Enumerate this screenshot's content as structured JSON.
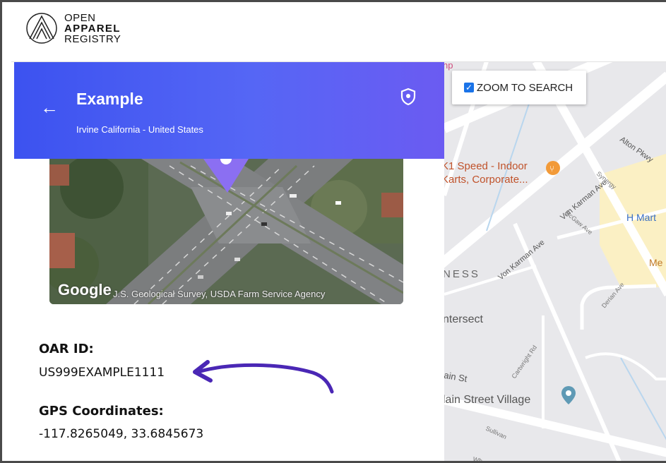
{
  "app": {
    "logo_line1": "OPEN",
    "logo_line2": "APPAREL",
    "logo_line3": "REGISTRY"
  },
  "facility": {
    "name": "Example",
    "location": "Irvine California - United States",
    "oar_id_label": "OAR ID:",
    "oar_id": "US999EXAMPLE1111",
    "gps_label": "GPS Coordinates:",
    "gps": "-117.8265049, 33.6845673"
  },
  "photo": {
    "provider": "Google",
    "attribution": "J.S. Geological Survey, USDA Farm Service Agency"
  },
  "map": {
    "zoom_label": "ZOOM TO SEARCH",
    "zoom_checked": true,
    "places": {
      "alton": "Alton Pkwy",
      "vonkarman1": "Von Karman Ave",
      "vonkarman2": "Von Karman Ave",
      "synergy": "Synergy",
      "mcgaw": "McGaw Ave",
      "hmart": "H Mart",
      "speed1": "K1 Speed - Indoor",
      "speed2": "Karts, Corporate...",
      "ness": "NESS",
      "me": "Me",
      "derian": "Derian Ave",
      "intersect": "ntersect",
      "cartwright": "Cartwright Rd",
      "mainst": "lain St",
      "village": "lain Street Village",
      "sullivan": "Sullivan",
      "mp": "np",
      "wh": "Wh"
    }
  },
  "colors": {
    "banner_start": "#3c52f0",
    "banner_end": "#6b5bf2",
    "arrow": "#4a27b5",
    "checkbox": "#1a73e8"
  }
}
